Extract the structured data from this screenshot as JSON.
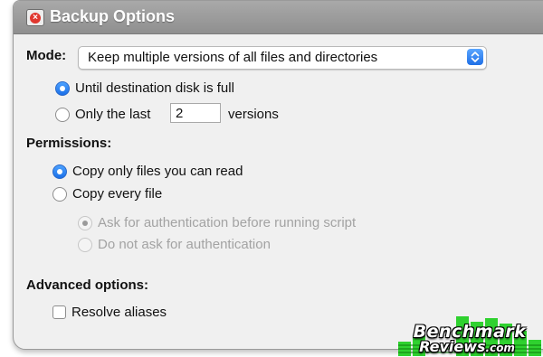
{
  "window": {
    "title": "Backup Options",
    "close_icon": "close-icon"
  },
  "mode": {
    "label": "Mode:",
    "selected": "Keep multiple versions of all files and directories",
    "options": [
      {
        "label": "Until destination disk is full",
        "selected": true
      },
      {
        "label": "Only the last",
        "selected": false
      }
    ],
    "versions_value": "2",
    "versions_suffix": "versions"
  },
  "permissions": {
    "label": "Permissions:",
    "options": [
      {
        "label": "Copy only files you can read",
        "selected": true
      },
      {
        "label": "Copy every file",
        "selected": false
      }
    ],
    "sub_options": [
      {
        "label": "Ask for authentication before running script",
        "selected": true,
        "enabled": false
      },
      {
        "label": "Do not ask for authentication",
        "selected": false,
        "enabled": false
      }
    ]
  },
  "advanced": {
    "label": "Advanced options:",
    "resolve_aliases_label": "Resolve aliases",
    "resolve_aliases_checked": false
  },
  "watermark": {
    "line1": "Benchmark",
    "line2": "Reviews",
    "line3": ".com",
    "accent": "#2fd12f"
  },
  "colors": {
    "accent": "#1a6fe8",
    "titlebar": "#9c9c9c",
    "panel": "#f0f0f0"
  }
}
